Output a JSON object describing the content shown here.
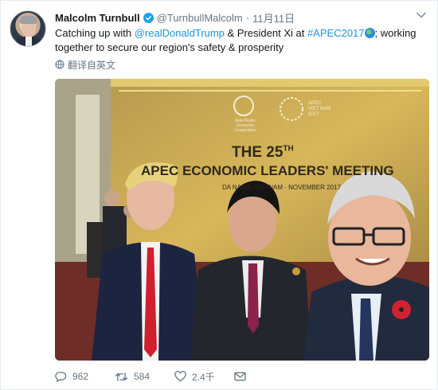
{
  "tweet": {
    "author_name": "Malcolm Turnbull",
    "handle": "@TurnbullMalcolm",
    "separator": "·",
    "timestamp": "11月11日",
    "text": {
      "part1": "Catching up with ",
      "mention": "@realDonaldTrump",
      "part2": " & President Xi at ",
      "hashtag": "#APEC2017",
      "part3": "; working together to secure our region's safety & prosperity"
    },
    "translate_label": "翻译自英文",
    "photo": {
      "banner_line1": "THE 25",
      "banner_sup": "TH",
      "banner_line2": "APEC ECONOMIC LEADERS' MEETING",
      "banner_line3": "DA NANG, VIETNAM · NOVEMBER 2017",
      "logo_caption": "Asia-Pacific Economic Cooperation",
      "logo2_line1": "APEC",
      "logo2_line2": "VIET NAM",
      "logo2_line3": "2017"
    },
    "actions": {
      "replies": "962",
      "retweets": "584",
      "likes": "2.4千"
    }
  },
  "colors": {
    "link": "#1b95e0",
    "muted": "#657786",
    "verified": "#1da1f2",
    "text": "#14171a"
  },
  "icons": [
    "verified-icon",
    "chevron-down-icon",
    "globe-icon",
    "translate-icon",
    "reply-icon",
    "retweet-icon",
    "like-icon",
    "message-icon"
  ]
}
